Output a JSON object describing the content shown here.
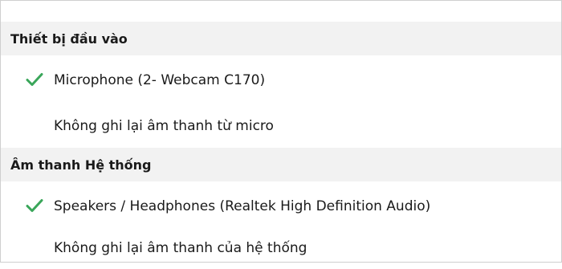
{
  "menu": {
    "input_section": {
      "title": "Thiết bị đầu vào",
      "items": [
        {
          "label": "Microphone (2- Webcam C170)",
          "checked": true,
          "icon": "checkmark-icon"
        },
        {
          "label": "Không ghi lại âm thanh từ micro",
          "checked": false
        }
      ]
    },
    "system_section": {
      "title": "Âm thanh Hệ thống",
      "items": [
        {
          "label": "Speakers / Headphones (Realtek High Definition Audio)",
          "checked": true,
          "icon": "checkmark-icon"
        },
        {
          "label": "Không ghi lại âm thanh của hệ thống",
          "checked": false
        }
      ]
    },
    "colors": {
      "check": "#3aa65a",
      "header_bg": "#f2f2f2"
    }
  }
}
